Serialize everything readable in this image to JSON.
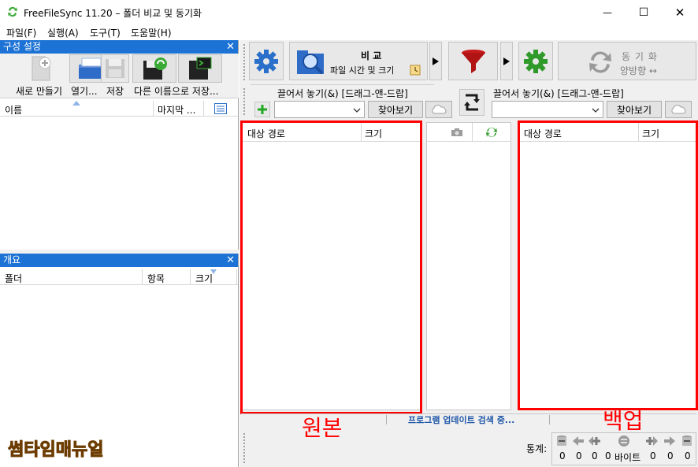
{
  "window": {
    "title": "FreeFileSync 11.20 – 폴더 비교 및 동기화",
    "minimize": "—",
    "maximize": "☐",
    "close": "✕"
  },
  "menu": [
    "파일(F)",
    "실행(A)",
    "도구(T)",
    "도움말(H)"
  ],
  "config_panel": {
    "title": "구성 설정",
    "close": "✕",
    "buttons": [
      "새로 만들기",
      "열기...",
      "저장",
      "다른 이름으로 저장..."
    ],
    "col_name": "이름",
    "col_last": "마지막 ..."
  },
  "overview_panel": {
    "title": "개요",
    "close": "✕",
    "col_folder": "폴더",
    "col_items": "항목",
    "col_size": "크기"
  },
  "toolbar": {
    "compare_title": "비 교",
    "compare_sub": "파일 시간 및 크기",
    "sync_title": "동 기 화",
    "sync_sub": "양방향 ↔"
  },
  "left_folder": {
    "label": "끌어서 놓기(&) [드래그-앤-드랍]",
    "browse": "찾아보기"
  },
  "right_folder": {
    "label": "끌어서 놓기(&) [드래그-앤-드랍]",
    "browse": "찾아보기"
  },
  "grids": {
    "left_path": "대상 경로",
    "left_size": "크기",
    "right_path": "대상 경로",
    "right_size": "크기"
  },
  "status": {
    "update_check": "프로그램 업데이트 검색 중...",
    "stats_label": "통계:",
    "counts": [
      "0",
      "0",
      "0",
      "0",
      "0",
      "0",
      "0"
    ],
    "bytes_label": "바이트"
  },
  "annotations": {
    "left": "원본",
    "right": "백업",
    "watermark": "썸타임매뉴얼"
  },
  "colors": {
    "panel_header": "#1c73d5",
    "annotation_red": "#ff0000",
    "watermark": "#f5a800"
  }
}
